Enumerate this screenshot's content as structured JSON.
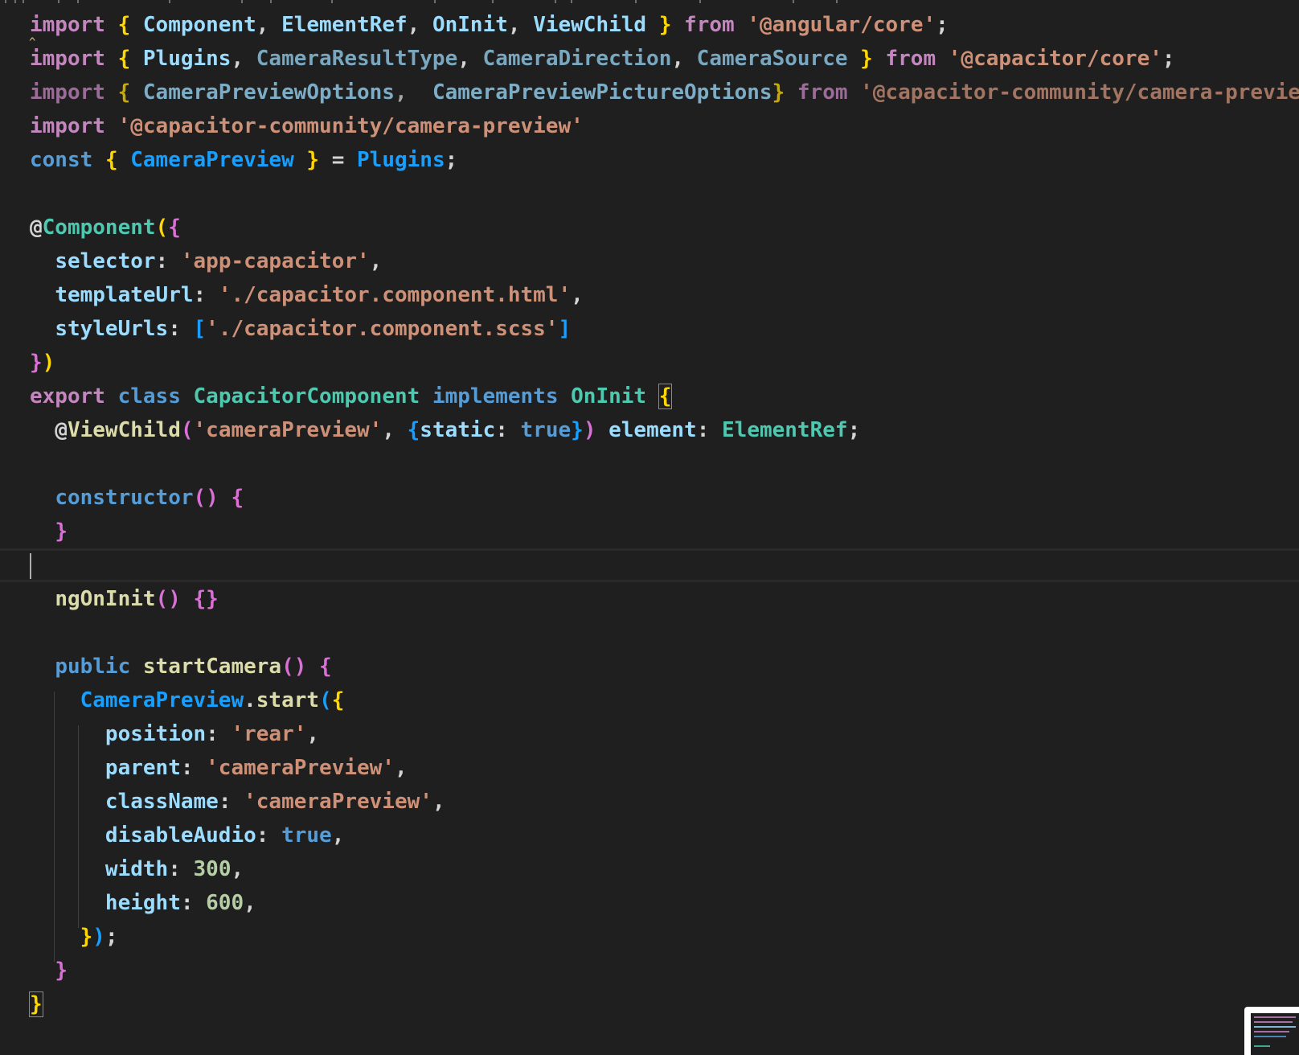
{
  "editor": {
    "language": "typescript",
    "theme_background": "#1f1f1f",
    "lines": [
      {
        "tokens": [
          [
            "kw-purple",
            "import"
          ],
          [
            "plain",
            " "
          ],
          [
            "y",
            "{"
          ],
          [
            "plain",
            " "
          ],
          [
            "ident",
            "Component"
          ],
          [
            "plain",
            ", "
          ],
          [
            "ident",
            "ElementRef"
          ],
          [
            "plain",
            ", "
          ],
          [
            "ident",
            "OnInit"
          ],
          [
            "plain",
            ", "
          ],
          [
            "ident",
            "ViewChild"
          ],
          [
            "plain",
            " "
          ],
          [
            "y",
            "}"
          ],
          [
            "plain",
            " "
          ],
          [
            "kw-purple",
            "from"
          ],
          [
            "plain",
            " "
          ],
          [
            "str",
            "'@angular/core'"
          ],
          [
            "plain",
            ";"
          ]
        ]
      },
      {
        "tokens": [
          [
            "kw-purple",
            "import"
          ],
          [
            "plain",
            " "
          ],
          [
            "y",
            "{"
          ],
          [
            "plain",
            " "
          ],
          [
            "ident",
            "Plugins"
          ],
          [
            "plain",
            ", "
          ],
          [
            "ident faded",
            "CameraResultType"
          ],
          [
            "plain",
            ", "
          ],
          [
            "ident faded",
            "CameraDirection"
          ],
          [
            "plain",
            ", "
          ],
          [
            "ident faded",
            "CameraSource"
          ],
          [
            "plain",
            " "
          ],
          [
            "y",
            "}"
          ],
          [
            "plain",
            " "
          ],
          [
            "kw-purple",
            "from"
          ],
          [
            "plain",
            " "
          ],
          [
            "str",
            "'@capacitor/core'"
          ],
          [
            "plain",
            ";"
          ]
        ]
      },
      {
        "faded": true,
        "tokens": [
          [
            "kw-purple",
            "import"
          ],
          [
            "plain",
            " "
          ],
          [
            "y",
            "{"
          ],
          [
            "plain",
            " "
          ],
          [
            "ident",
            "CameraPreviewOptions"
          ],
          [
            "plain",
            ",  "
          ],
          [
            "ident",
            "CameraPreviewPictureOptions"
          ],
          [
            "y",
            "}"
          ],
          [
            "plain",
            " "
          ],
          [
            "kw-purple",
            "from"
          ],
          [
            "plain",
            " "
          ],
          [
            "str",
            "'@capacitor-community/camera-preview'"
          ]
        ]
      },
      {
        "tokens": [
          [
            "kw-purple",
            "import"
          ],
          [
            "plain",
            " "
          ],
          [
            "str",
            "'@capacitor-community/camera-preview'"
          ]
        ]
      },
      {
        "tokens": [
          [
            "kw-blue",
            "const"
          ],
          [
            "plain",
            " "
          ],
          [
            "y",
            "{"
          ],
          [
            "plain",
            " "
          ],
          [
            "b",
            "CameraPreview"
          ],
          [
            "plain",
            " "
          ],
          [
            "y",
            "}"
          ],
          [
            "plain",
            " = "
          ],
          [
            "b",
            "Plugins"
          ],
          [
            "plain",
            ";"
          ]
        ]
      },
      {
        "tokens": []
      },
      {
        "tokens": [
          [
            "plain",
            "@"
          ],
          [
            "cls",
            "Component"
          ],
          [
            "y",
            "("
          ],
          [
            "p",
            "{"
          ]
        ]
      },
      {
        "tokens": [
          [
            "plain",
            "  "
          ],
          [
            "ident",
            "selector"
          ],
          [
            "plain",
            ": "
          ],
          [
            "str",
            "'app-capacitor'"
          ],
          [
            "plain",
            ","
          ]
        ]
      },
      {
        "tokens": [
          [
            "plain",
            "  "
          ],
          [
            "ident",
            "templateUrl"
          ],
          [
            "plain",
            ": "
          ],
          [
            "str",
            "'./capacitor.component.html'"
          ],
          [
            "plain",
            ","
          ]
        ]
      },
      {
        "tokens": [
          [
            "plain",
            "  "
          ],
          [
            "ident",
            "styleUrls"
          ],
          [
            "plain",
            ": "
          ],
          [
            "b",
            "["
          ],
          [
            "str",
            "'./capacitor.component.scss'"
          ],
          [
            "b",
            "]"
          ]
        ]
      },
      {
        "tokens": [
          [
            "p",
            "}"
          ],
          [
            "y",
            ")"
          ]
        ]
      },
      {
        "tokens": [
          [
            "kw-purple",
            "export"
          ],
          [
            "plain",
            " "
          ],
          [
            "kw-blue",
            "class"
          ],
          [
            "plain",
            " "
          ],
          [
            "cls",
            "CapacitorComponent"
          ],
          [
            "plain",
            " "
          ],
          [
            "kw-blue",
            "implements"
          ],
          [
            "plain",
            " "
          ],
          [
            "cls",
            "OnInit"
          ],
          [
            "plain",
            " "
          ],
          [
            "y bracket-box",
            "{"
          ]
        ]
      },
      {
        "tokens": [
          [
            "plain",
            "  @"
          ],
          [
            "fn",
            "ViewChild"
          ],
          [
            "p",
            "("
          ],
          [
            "str",
            "'cameraPreview'"
          ],
          [
            "plain",
            ", "
          ],
          [
            "b",
            "{"
          ],
          [
            "ident",
            "static"
          ],
          [
            "plain",
            ": "
          ],
          [
            "kw-blue",
            "true"
          ],
          [
            "b",
            "}"
          ],
          [
            "p",
            ")"
          ],
          [
            "plain",
            " "
          ],
          [
            "ident",
            "element"
          ],
          [
            "plain",
            ": "
          ],
          [
            "cls",
            "ElementRef"
          ],
          [
            "plain",
            ";"
          ]
        ]
      },
      {
        "tokens": []
      },
      {
        "tokens": [
          [
            "plain",
            "  "
          ],
          [
            "kw-blue",
            "constructor"
          ],
          [
            "p",
            "()"
          ],
          [
            "plain",
            " "
          ],
          [
            "p",
            "{"
          ]
        ]
      },
      {
        "tokens": [
          [
            "plain",
            "  "
          ],
          [
            "p",
            "}"
          ]
        ]
      },
      {
        "current": true,
        "tokens": []
      },
      {
        "tokens": [
          [
            "plain",
            "  "
          ],
          [
            "fn",
            "ngOnInit"
          ],
          [
            "p",
            "()"
          ],
          [
            "plain",
            " "
          ],
          [
            "p",
            "{}"
          ]
        ]
      },
      {
        "tokens": []
      },
      {
        "tokens": [
          [
            "plain",
            "  "
          ],
          [
            "kw-blue",
            "public"
          ],
          [
            "plain",
            " "
          ],
          [
            "fn",
            "startCamera"
          ],
          [
            "p",
            "()"
          ],
          [
            "plain",
            " "
          ],
          [
            "p",
            "{"
          ]
        ]
      },
      {
        "tokens": [
          [
            "plain",
            "    "
          ],
          [
            "b",
            "CameraPreview"
          ],
          [
            "plain",
            "."
          ],
          [
            "fn",
            "start"
          ],
          [
            "b",
            "("
          ],
          [
            "y",
            "{"
          ]
        ]
      },
      {
        "tokens": [
          [
            "plain",
            "      "
          ],
          [
            "ident",
            "position"
          ],
          [
            "plain",
            ": "
          ],
          [
            "str",
            "'rear'"
          ],
          [
            "plain",
            ","
          ]
        ]
      },
      {
        "tokens": [
          [
            "plain",
            "      "
          ],
          [
            "ident",
            "parent"
          ],
          [
            "plain",
            ": "
          ],
          [
            "str",
            "'cameraPreview'"
          ],
          [
            "plain",
            ","
          ]
        ]
      },
      {
        "tokens": [
          [
            "plain",
            "      "
          ],
          [
            "ident",
            "className"
          ],
          [
            "plain",
            ": "
          ],
          [
            "str",
            "'cameraPreview'"
          ],
          [
            "plain",
            ","
          ]
        ]
      },
      {
        "tokens": [
          [
            "plain",
            "      "
          ],
          [
            "ident",
            "disableAudio"
          ],
          [
            "plain",
            ": "
          ],
          [
            "kw-blue",
            "true"
          ],
          [
            "plain",
            ","
          ]
        ]
      },
      {
        "tokens": [
          [
            "plain",
            "      "
          ],
          [
            "ident",
            "width"
          ],
          [
            "plain",
            ": "
          ],
          [
            "num",
            "300"
          ],
          [
            "plain",
            ","
          ]
        ]
      },
      {
        "tokens": [
          [
            "plain",
            "      "
          ],
          [
            "ident",
            "height"
          ],
          [
            "plain",
            ": "
          ],
          [
            "num",
            "600"
          ],
          [
            "plain",
            ","
          ]
        ]
      },
      {
        "tokens": [
          [
            "plain",
            "    "
          ],
          [
            "y",
            "}"
          ],
          [
            "b",
            ")"
          ],
          [
            "plain",
            ";"
          ]
        ]
      },
      {
        "tokens": [
          [
            "plain",
            "  "
          ],
          [
            "p",
            "}"
          ]
        ]
      },
      {
        "tokens": [
          [
            "y bracket-box",
            "}"
          ]
        ]
      }
    ]
  },
  "minimap": {
    "label": "minimap"
  }
}
